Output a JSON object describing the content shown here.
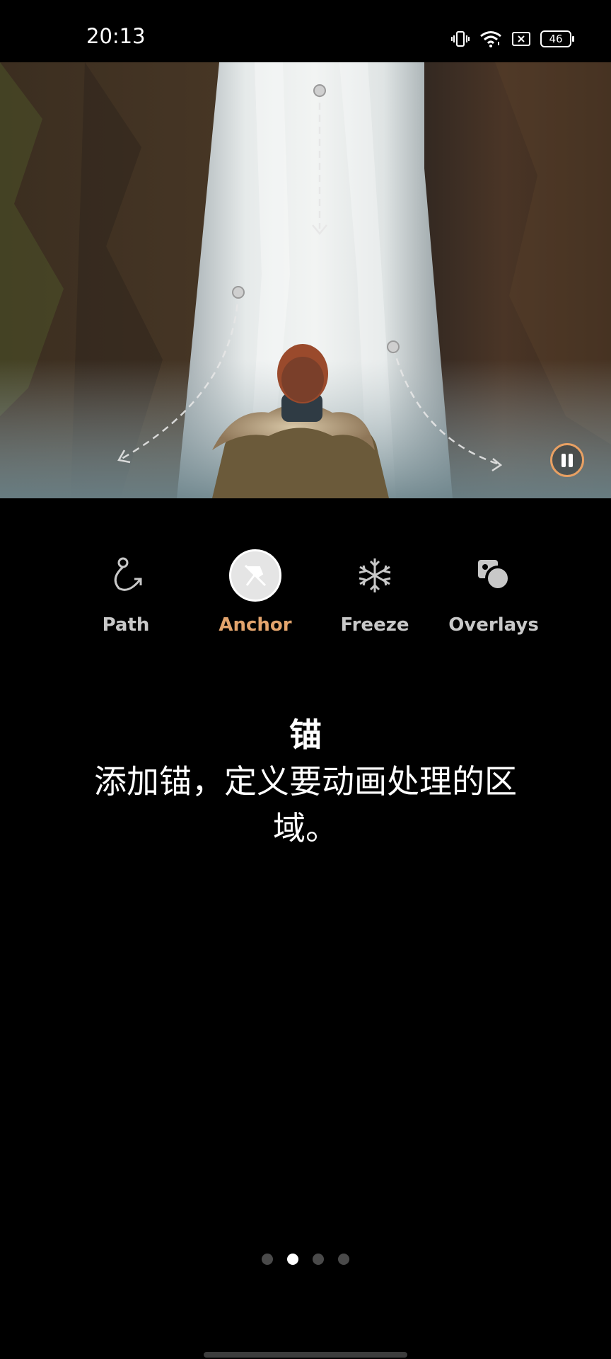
{
  "status_bar": {
    "time": "20:13",
    "battery": "46"
  },
  "tools": [
    {
      "label": "Path",
      "icon": "path-curve-arrow-icon"
    },
    {
      "label": "Anchor",
      "icon": "anchor-pin-icon",
      "active": true
    },
    {
      "label": "Freeze",
      "icon": "snowflake-icon"
    },
    {
      "label": "Overlays",
      "icon": "overlays-shapes-icon"
    }
  ],
  "description": {
    "title": "锚",
    "body": "添加锚，定义要动画处理的区域。"
  },
  "pager": {
    "total": 4,
    "current": 2
  },
  "colors": {
    "accent": "#e3a46d",
    "background": "#000000"
  }
}
